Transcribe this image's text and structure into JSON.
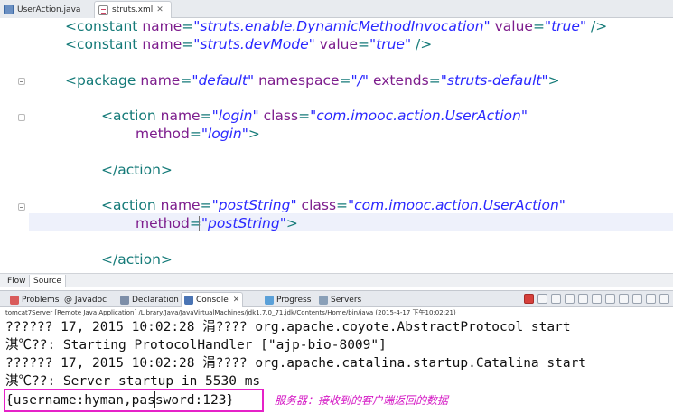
{
  "editor_tabs": [
    {
      "label": "UserAction.java",
      "icon": "java-file-icon"
    },
    {
      "label": "struts.xml",
      "icon": "xml-file-icon"
    }
  ],
  "code": {
    "l1": {
      "tag": "<constant",
      "a1": "name",
      "v1": "\"struts.enable.DynamicMethodInvocation\"",
      "a2": "value",
      "v2": "\"true\"",
      "end": "/>"
    },
    "l2": {
      "tag": "<constant",
      "a1": "name",
      "v1": "\"struts.devMode\"",
      "a2": "value",
      "v2": "\"true\"",
      "end": "/>"
    },
    "l3": {
      "tag": "<package",
      "a1": "name",
      "v1": "\"default\"",
      "a2": "namespace",
      "v2": "\"/\"",
      "a3": "extends",
      "v3": "\"struts-default\"",
      "end": ">"
    },
    "l4": {
      "tag": "<action",
      "a1": "name",
      "v1": "\"login\"",
      "a2": "class",
      "v2": "\"com.imooc.action.UserAction\""
    },
    "l5": {
      "a1": "method",
      "v1": "\"login\"",
      "end": ">"
    },
    "l6": {
      "tag": "</action>"
    },
    "l7": {
      "tag": "<action",
      "a1": "name",
      "v1": "\"postString\"",
      "a2": "class",
      "v2": "\"com.imooc.action.UserAction\""
    },
    "l8": {
      "a1": "method",
      "v1": "\"postString\"",
      "end": ">"
    },
    "l9": {
      "tag": "</action>"
    }
  },
  "flow_source_tabs": {
    "flow": "Flow",
    "source": "Source"
  },
  "view_tabs": [
    {
      "label": "Problems"
    },
    {
      "label": "@ Javadoc"
    },
    {
      "label": "Declaration"
    },
    {
      "label": "Console"
    },
    {
      "label": "Progress"
    },
    {
      "label": "Servers"
    }
  ],
  "console_header": "tomcat7Server [Remote Java Application] /Library/Java/JavaVirtualMachines/jdk1.7.0_71.jdk/Contents/Home/bin/java (2015-4-17 下午10:02:21)",
  "console_lines": [
    "?????? 17, 2015 10:02:28 涓???? org.apache.coyote.AbstractProtocol start",
    "淇℃??: Starting ProtocolHandler [\"ajp-bio-8009\"]",
    "?????? 17, 2015 10:02:28 涓???? org.apache.catalina.startup.Catalina start",
    "淇℃??: Server startup in 5530 ms",
    "{username:hyman,password:123}"
  ],
  "annotation": "服务器：接收到的客户端返回的数据",
  "colors": {
    "highlight": "#e621c8",
    "annotation": "#d417c4",
    "attr": "#7d1d8d",
    "value": "#2a28ff",
    "tag": "#147a78"
  }
}
